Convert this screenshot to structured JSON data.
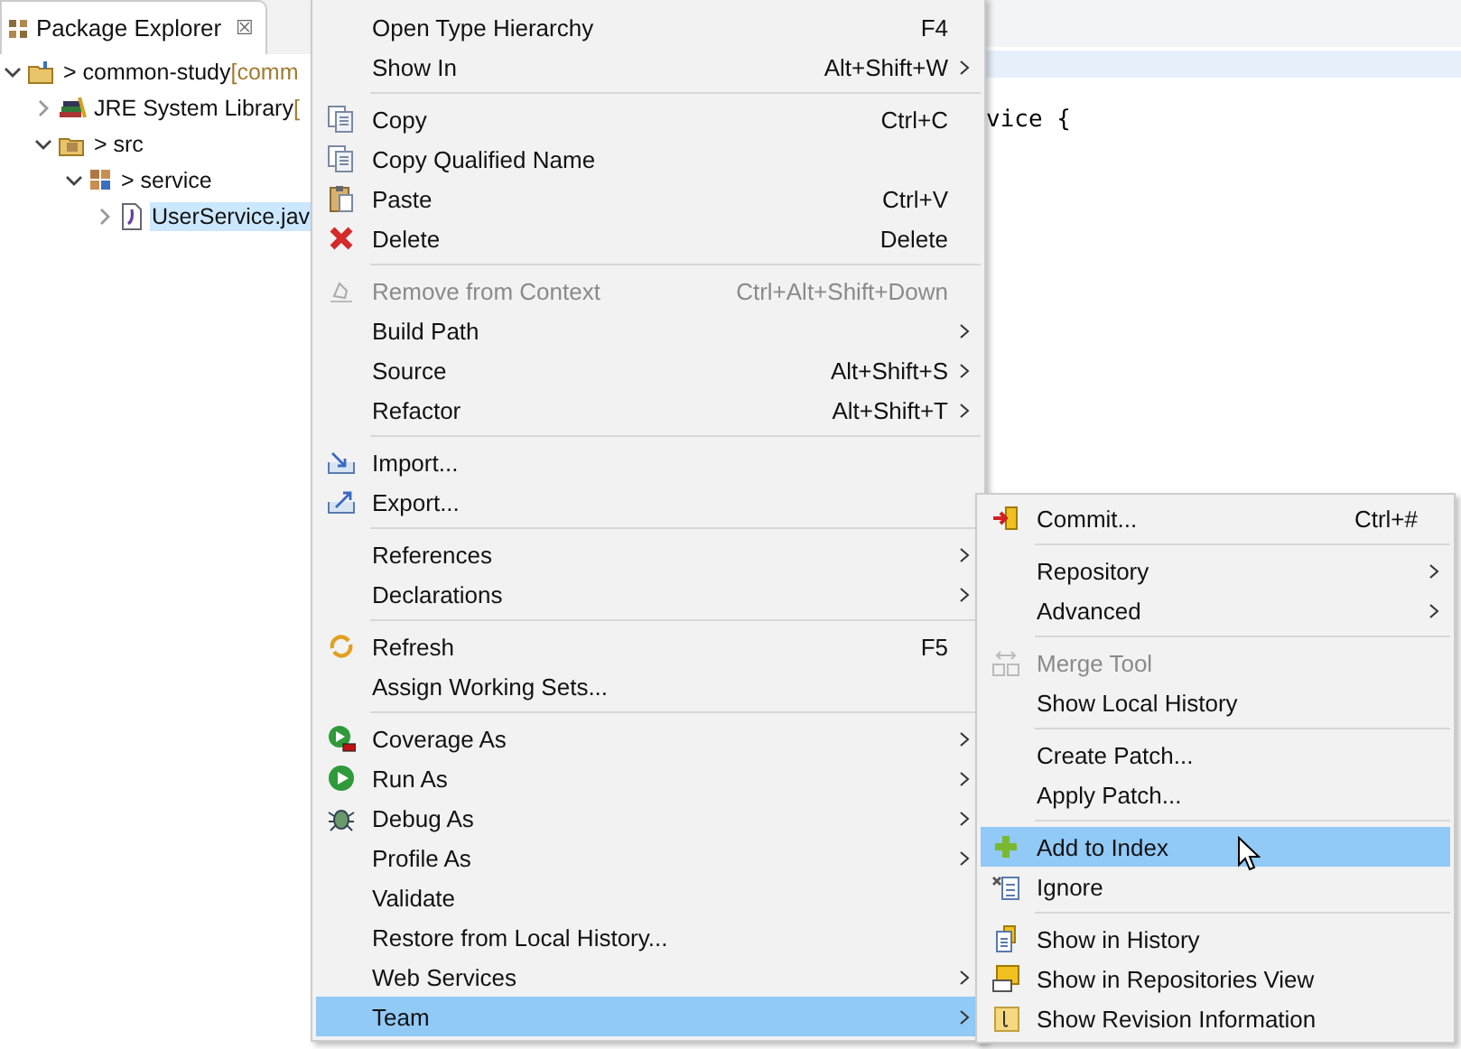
{
  "explorer": {
    "title": "Package Explorer",
    "close": "☒",
    "tree": [
      {
        "label": "> common-study",
        "decoration": "[comm",
        "kind": "project",
        "expanded": true,
        "selected": false,
        "children": [
          {
            "label": "JRE System Library",
            "decoration": "[",
            "kind": "library",
            "expanded": false,
            "selected": false
          },
          {
            "label": "> src",
            "kind": "source",
            "expanded": true,
            "selected": false,
            "children": [
              {
                "label": "> service",
                "kind": "package",
                "expanded": true,
                "selected": false,
                "children": [
                  {
                    "label": "UserService.jav",
                    "kind": "file",
                    "expanded": false,
                    "selected": true
                  }
                ]
              }
            ]
          }
        ]
      }
    ]
  },
  "editor": {
    "code_line": "vice {"
  },
  "context_menu": {
    "groups": [
      [
        {
          "label": "Open Type Hierarchy",
          "shortcut": "F4",
          "submenu": false,
          "disabled": false,
          "selected": false
        },
        {
          "label": "Show In",
          "shortcut": "Alt+Shift+W",
          "submenu": true,
          "disabled": false,
          "selected": false
        }
      ],
      [
        {
          "label": "Copy",
          "shortcut": "Ctrl+C",
          "submenu": false,
          "disabled": false,
          "selected": false
        },
        {
          "label": "Copy Qualified Name",
          "submenu": false,
          "disabled": false,
          "selected": false
        },
        {
          "label": "Paste",
          "shortcut": "Ctrl+V",
          "submenu": false,
          "disabled": false,
          "selected": false
        },
        {
          "label": "Delete",
          "shortcut": "Delete",
          "submenu": false,
          "disabled": false,
          "selected": false
        }
      ],
      [
        {
          "label": "Remove from Context",
          "shortcut": "Ctrl+Alt+Shift+Down",
          "submenu": false,
          "disabled": true,
          "selected": false
        },
        {
          "label": "Build Path",
          "submenu": true,
          "disabled": false,
          "selected": false
        },
        {
          "label": "Source",
          "shortcut": "Alt+Shift+S",
          "submenu": true,
          "disabled": false,
          "selected": false
        },
        {
          "label": "Refactor",
          "shortcut": "Alt+Shift+T",
          "submenu": true,
          "disabled": false,
          "selected": false
        }
      ],
      [
        {
          "label": "Import...",
          "submenu": false,
          "disabled": false,
          "selected": false
        },
        {
          "label": "Export...",
          "submenu": false,
          "disabled": false,
          "selected": false
        }
      ],
      [
        {
          "label": "References",
          "submenu": true,
          "disabled": false,
          "selected": false
        },
        {
          "label": "Declarations",
          "submenu": true,
          "disabled": false,
          "selected": false
        }
      ],
      [
        {
          "label": "Refresh",
          "shortcut": "F5",
          "submenu": false,
          "disabled": false,
          "selected": false
        },
        {
          "label": "Assign Working Sets...",
          "submenu": false,
          "disabled": false,
          "selected": false
        }
      ],
      [
        {
          "label": "Coverage As",
          "submenu": true,
          "disabled": false,
          "selected": false
        },
        {
          "label": "Run As",
          "submenu": true,
          "disabled": false,
          "selected": false
        },
        {
          "label": "Debug As",
          "submenu": true,
          "disabled": false,
          "selected": false
        },
        {
          "label": "Profile As",
          "submenu": true,
          "disabled": false,
          "selected": false
        },
        {
          "label": "Validate",
          "submenu": false,
          "disabled": false,
          "selected": false
        },
        {
          "label": "Restore from Local History...",
          "submenu": false,
          "disabled": false,
          "selected": false
        },
        {
          "label": "Web Services",
          "submenu": true,
          "disabled": false,
          "selected": false
        },
        {
          "label": "Team",
          "submenu": true,
          "disabled": false,
          "selected": true
        }
      ]
    ]
  },
  "team_menu": {
    "groups": [
      [
        {
          "label": "Commit...",
          "shortcut": "Ctrl+#",
          "submenu": false,
          "disabled": false,
          "selected": false
        }
      ],
      [
        {
          "label": "Repository",
          "submenu": true,
          "disabled": false,
          "selected": false
        },
        {
          "label": "Advanced",
          "submenu": true,
          "disabled": false,
          "selected": false
        }
      ],
      [
        {
          "label": "Merge Tool",
          "submenu": false,
          "disabled": true,
          "selected": false
        },
        {
          "label": "Show Local History",
          "submenu": false,
          "disabled": false,
          "selected": false
        }
      ],
      [
        {
          "label": "Create Patch...",
          "submenu": false,
          "disabled": false,
          "selected": false
        },
        {
          "label": "Apply Patch...",
          "submenu": false,
          "disabled": false,
          "selected": false
        }
      ],
      [
        {
          "label": "Add to Index",
          "submenu": false,
          "disabled": false,
          "selected": true
        },
        {
          "label": "Ignore",
          "submenu": false,
          "disabled": false,
          "selected": false
        }
      ],
      [
        {
          "label": "Show in History",
          "submenu": false,
          "disabled": false,
          "selected": false
        },
        {
          "label": "Show in Repositories View",
          "submenu": false,
          "disabled": false,
          "selected": false
        },
        {
          "label": "Show Revision Information",
          "submenu": false,
          "disabled": false,
          "selected": false
        }
      ]
    ]
  }
}
